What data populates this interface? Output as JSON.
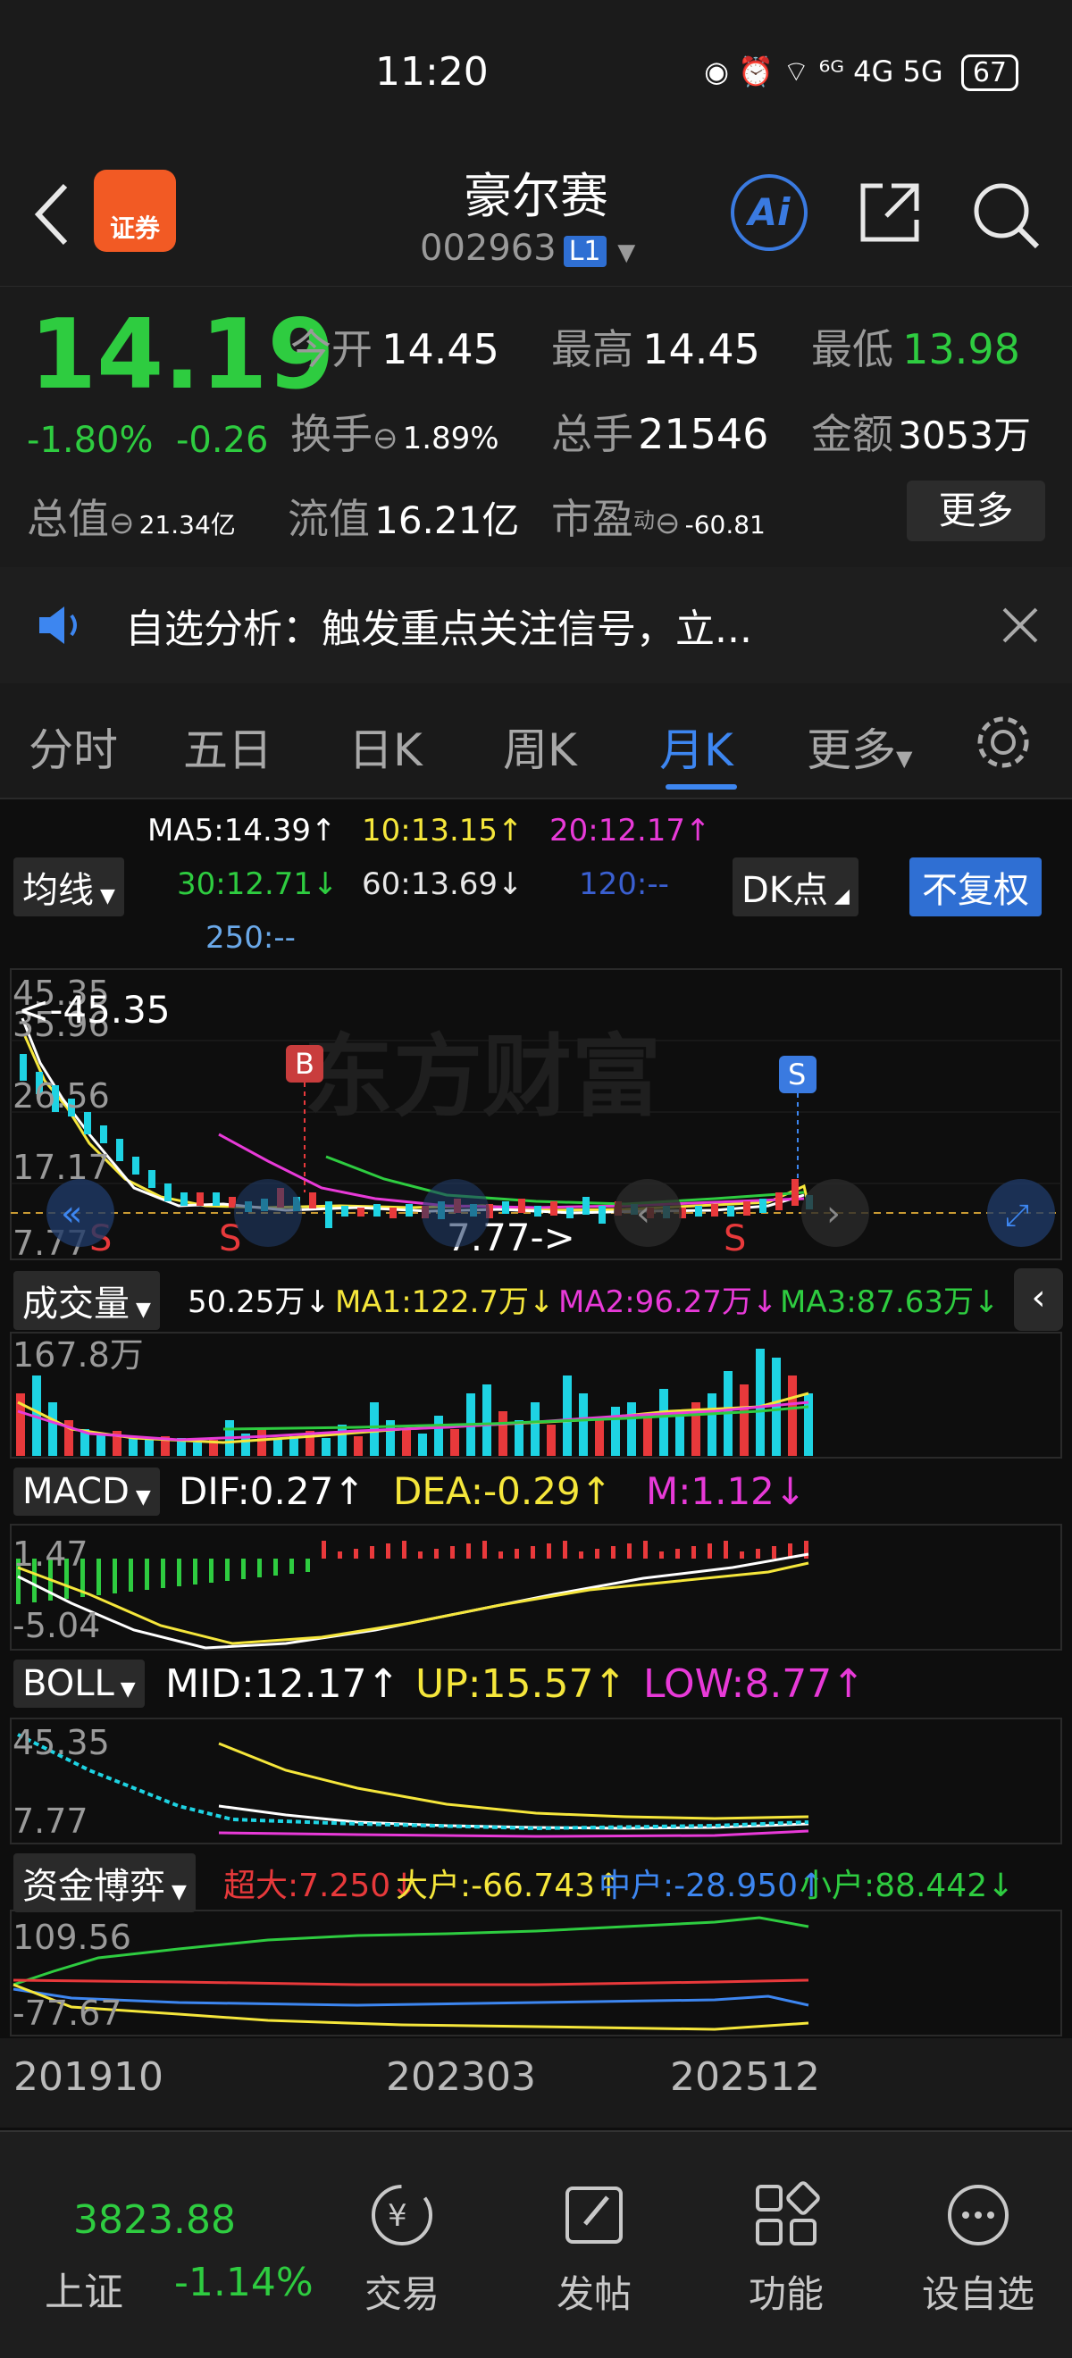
{
  "status_bar": {
    "time": "11:20",
    "signal": "⁶ᴳ 4G 5G",
    "battery": "67"
  },
  "header": {
    "title": "豪尔赛",
    "code": "002963",
    "code_badge": "L1",
    "app_logo_text": "证券",
    "ai_label": "Ai"
  },
  "quote": {
    "price": "14.19",
    "change_pct": "-1.80%",
    "change_amt": "-0.26",
    "open_label": "今开",
    "open": "14.45",
    "high_label": "最高",
    "high": "14.45",
    "low_label": "最低",
    "low": "13.98",
    "turnover_label": "换手",
    "turnover": "1.89%",
    "volume_label": "总手",
    "volume": "21546",
    "amount_label": "金额",
    "amount": "3053万",
    "mktcap_label": "总值",
    "mktcap": "21.34亿",
    "float_label": "流值",
    "float_cap": "16.21亿",
    "pe_label": "市盈",
    "pe_sup": "动",
    "pe": "-60.81",
    "more_label": "更多"
  },
  "notice": {
    "text": "自选分析：触发重点关注信号，立..."
  },
  "tabs": [
    "分时",
    "五日",
    "日K",
    "周K",
    "月K",
    "更多"
  ],
  "active_tab": "月K",
  "ma_legend": {
    "ma5": "MA5:14.39↑",
    "ma10": "10:13.15↑",
    "ma20": "20:12.17↑",
    "ma30": "30:12.71↓",
    "ma60": "60:13.69↓",
    "ma120": "120:--",
    "ma250": "250:--",
    "dropdown": "均线",
    "dk_label": "DK点",
    "fq_label": "不复权"
  },
  "kline": {
    "ytick_top": "45.35",
    "ytick_2": "35.96",
    "ytick_3": "26.56",
    "ytick_4": "17.17",
    "ytick_bottom": "7.77",
    "max_label": "<-45.35",
    "min_label": "7.77->",
    "signal_b": "B",
    "signal_s": "S",
    "watermark": "东方财富"
  },
  "volume": {
    "dropdown": "成交量",
    "value": "50.25万↓",
    "ma1": "MA1:122.7万↓",
    "ma2": "MA2:96.27万↓",
    "ma3": "MA3:87.63万↓",
    "ytick": "167.8万"
  },
  "macd": {
    "dropdown": "MACD",
    "dif": "DIF:0.27↑",
    "dea": "DEA:-0.29↑",
    "m": "M:1.12↓",
    "ytick_top": "1.47",
    "ytick_bottom": "-5.04"
  },
  "boll": {
    "dropdown": "BOLL",
    "mid": "MID:12.17↑",
    "up": "UP:15.57↑",
    "low": "LOW:8.77↑",
    "ytick_top": "45.35",
    "ytick_bottom": "7.77"
  },
  "fund": {
    "dropdown": "资金博弈",
    "super": "超大:7.250↓",
    "large": "大户:-66.743↑",
    "medium": "中户:-28.950↑",
    "small": "小户:88.442↓",
    "ytick_top": "109.56",
    "ytick_bottom": "-77.67"
  },
  "x_axis": [
    "201910",
    "202303",
    "202512"
  ],
  "bottom_nav": {
    "index_value": "3823.88",
    "index_name": "上证",
    "index_change": "-1.14%",
    "items": [
      "交易",
      "发帖",
      "功能",
      "设自选"
    ]
  },
  "colors": {
    "up": "#e8393b",
    "down": "#2ecc40",
    "accent": "#3d86f0",
    "ma5": "#ffffff",
    "ma10": "#f5e63b",
    "ma20": "#e83ad8",
    "ma30": "#2ecc40"
  }
}
